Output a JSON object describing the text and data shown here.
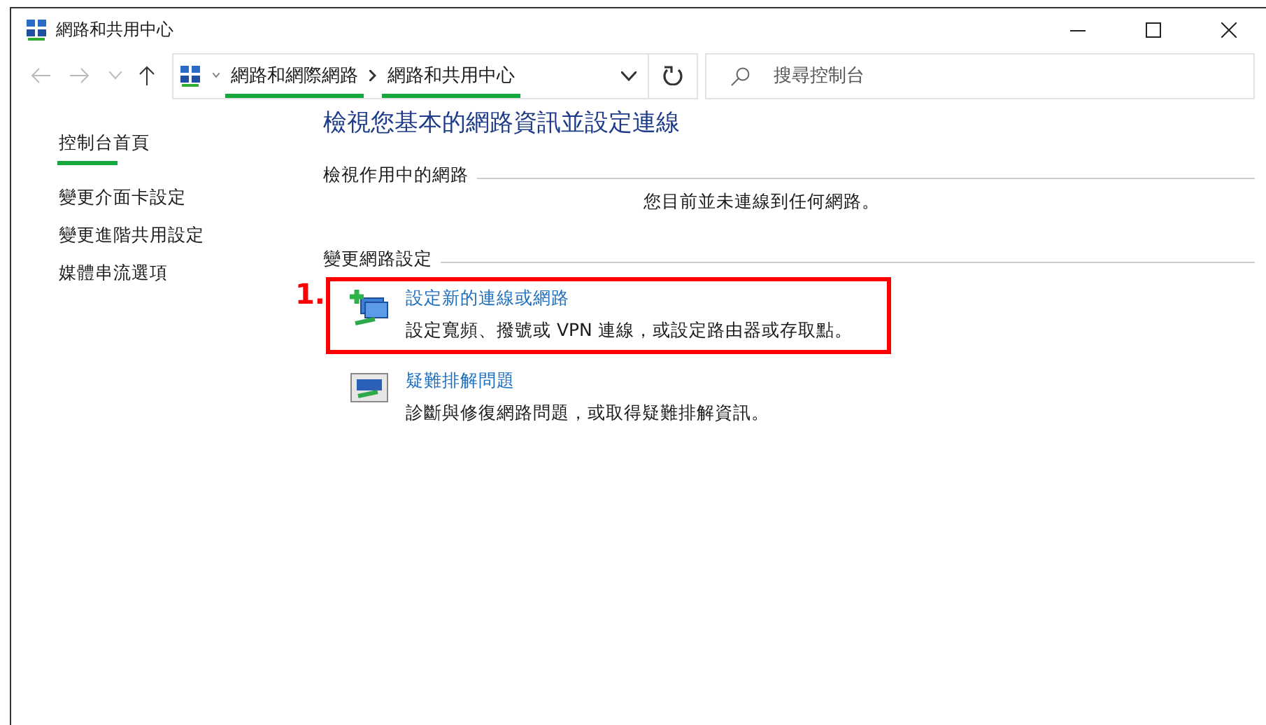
{
  "window": {
    "title": "網路和共用中心"
  },
  "address_bar": {
    "breadcrumbs": [
      {
        "label": "網路和網際網路",
        "highlighted": true
      },
      {
        "label": "網路和共用中心",
        "highlighted": true
      }
    ]
  },
  "search": {
    "placeholder": "搜尋控制台"
  },
  "sidebar": {
    "items": [
      {
        "label": "控制台首頁",
        "highlighted": true
      },
      {
        "label": "變更介面卡設定",
        "highlighted": false
      },
      {
        "label": "變更進階共用設定",
        "highlighted": false
      },
      {
        "label": "媒體串流選項",
        "highlighted": false
      }
    ]
  },
  "heading": "檢視您基本的網路資訊並設定連線",
  "sections": [
    {
      "title": "檢視作用中的網路",
      "text": "您目前並未連線到任何網路。"
    },
    {
      "title": "變更網路設定"
    }
  ],
  "tasks": [
    {
      "kind": "new-connection",
      "title": "設定新的連線或網路",
      "description": "設定寬頻、撥號或 VPN 連線，或設定路由器或存取點。",
      "highlighted": true,
      "annotation": "1."
    },
    {
      "kind": "troubleshoot",
      "title": "疑難排解問題",
      "description": "診斷與修復網路問題，或取得疑難排解資訊。",
      "highlighted": false
    }
  ]
}
